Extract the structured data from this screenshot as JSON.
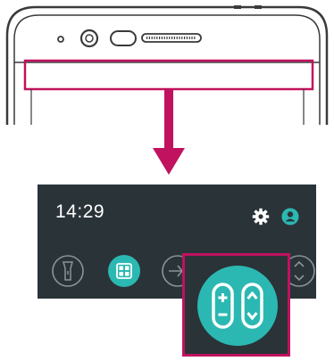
{
  "notification_panel": {
    "time": "14:29",
    "icons": {
      "settings": "gear-icon",
      "profile": "person-icon"
    },
    "quick_settings": [
      {
        "name": "flashlight",
        "icon": "flashlight-icon"
      },
      {
        "name": "quickmemo",
        "icon": "quickmemo-icon",
        "active": true
      },
      {
        "name": "airplane-mode",
        "icon": "airplane-icon"
      },
      {
        "name": "qslide",
        "icon": "circle-toggle-icon"
      },
      {
        "name": "volume-toggle",
        "icon": "up-down-icon"
      }
    ]
  },
  "callout": {
    "icon": "volume-keys-icon",
    "highlight_color": "#c0125e"
  },
  "colors": {
    "panel_bg": "#2a3338",
    "teal": "#2bb8b2",
    "arrow": "#c0125e",
    "phone_outline": "#3a3a3a"
  }
}
